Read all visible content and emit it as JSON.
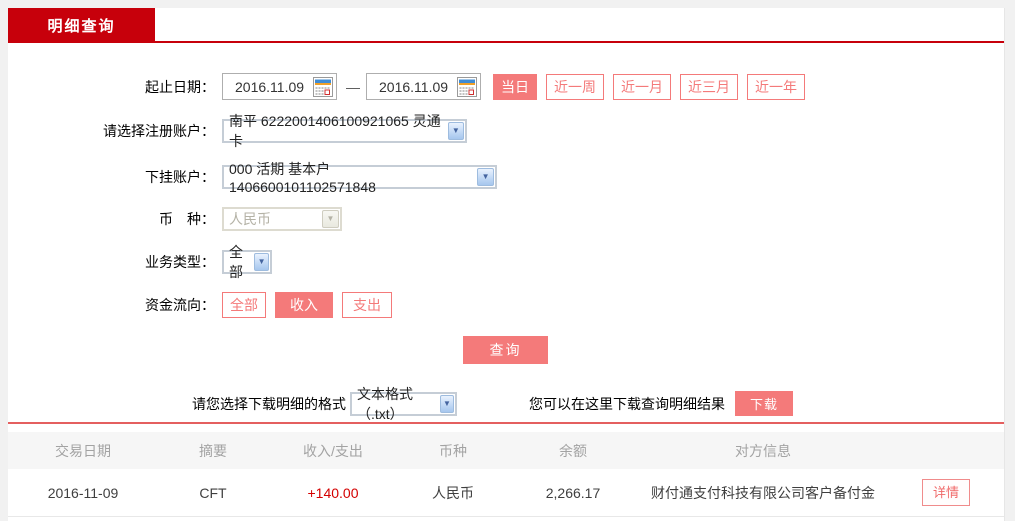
{
  "tab": {
    "label": "明细查询"
  },
  "icons": {
    "dropdown_arrow": "▼",
    "calendar": "calendar-grid-icon"
  },
  "form": {
    "date_row": {
      "label": "起止日期：",
      "start_date": "2016.11.09",
      "end_date": "2016.11.09",
      "separator": "—",
      "quick_buttons": [
        {
          "label": "当日",
          "active": true
        },
        {
          "label": "近一周",
          "active": false
        },
        {
          "label": "近一月",
          "active": false
        },
        {
          "label": "近三月",
          "active": false
        },
        {
          "label": "近一年",
          "active": false
        }
      ]
    },
    "register_account": {
      "label": "请选择注册账户：",
      "value": "南平 6222001406100921065 灵通卡"
    },
    "sub_account": {
      "label": "下挂账户：",
      "value": "000 活期 基本户 1406600101102571848"
    },
    "currency": {
      "label": "币　种：",
      "value": "人民币",
      "disabled": true
    },
    "business_type": {
      "label": "业务类型：",
      "value": "全部"
    },
    "fund_flow": {
      "label": "资金流向：",
      "options": [
        {
          "label": "全部",
          "active": false
        },
        {
          "label": "收入",
          "active": true
        },
        {
          "label": "支出",
          "active": false
        }
      ]
    },
    "query_button": "查询"
  },
  "download": {
    "format_label": "请您选择下载明细的格式",
    "format_value": "文本格式（.txt）",
    "hint": "您可以在这里下载查询明细结果",
    "button": "下载"
  },
  "table": {
    "headers": [
      "交易日期",
      "摘要",
      "收入/支出",
      "币种",
      "余额",
      "对方信息"
    ],
    "rows": [
      {
        "date": "2016-11-09",
        "summary": "CFT",
        "amount": "+140.00",
        "currency": "人民币",
        "balance": "2,266.17",
        "counterparty": "财付通支付科技有限公司客户备付金",
        "action": "详情"
      }
    ]
  },
  "colors": {
    "tab_red": "#c7000b",
    "salmon_accent": "#f47a7a",
    "amount_red": "#d40000",
    "page_bg": "#f1f1f1"
  }
}
